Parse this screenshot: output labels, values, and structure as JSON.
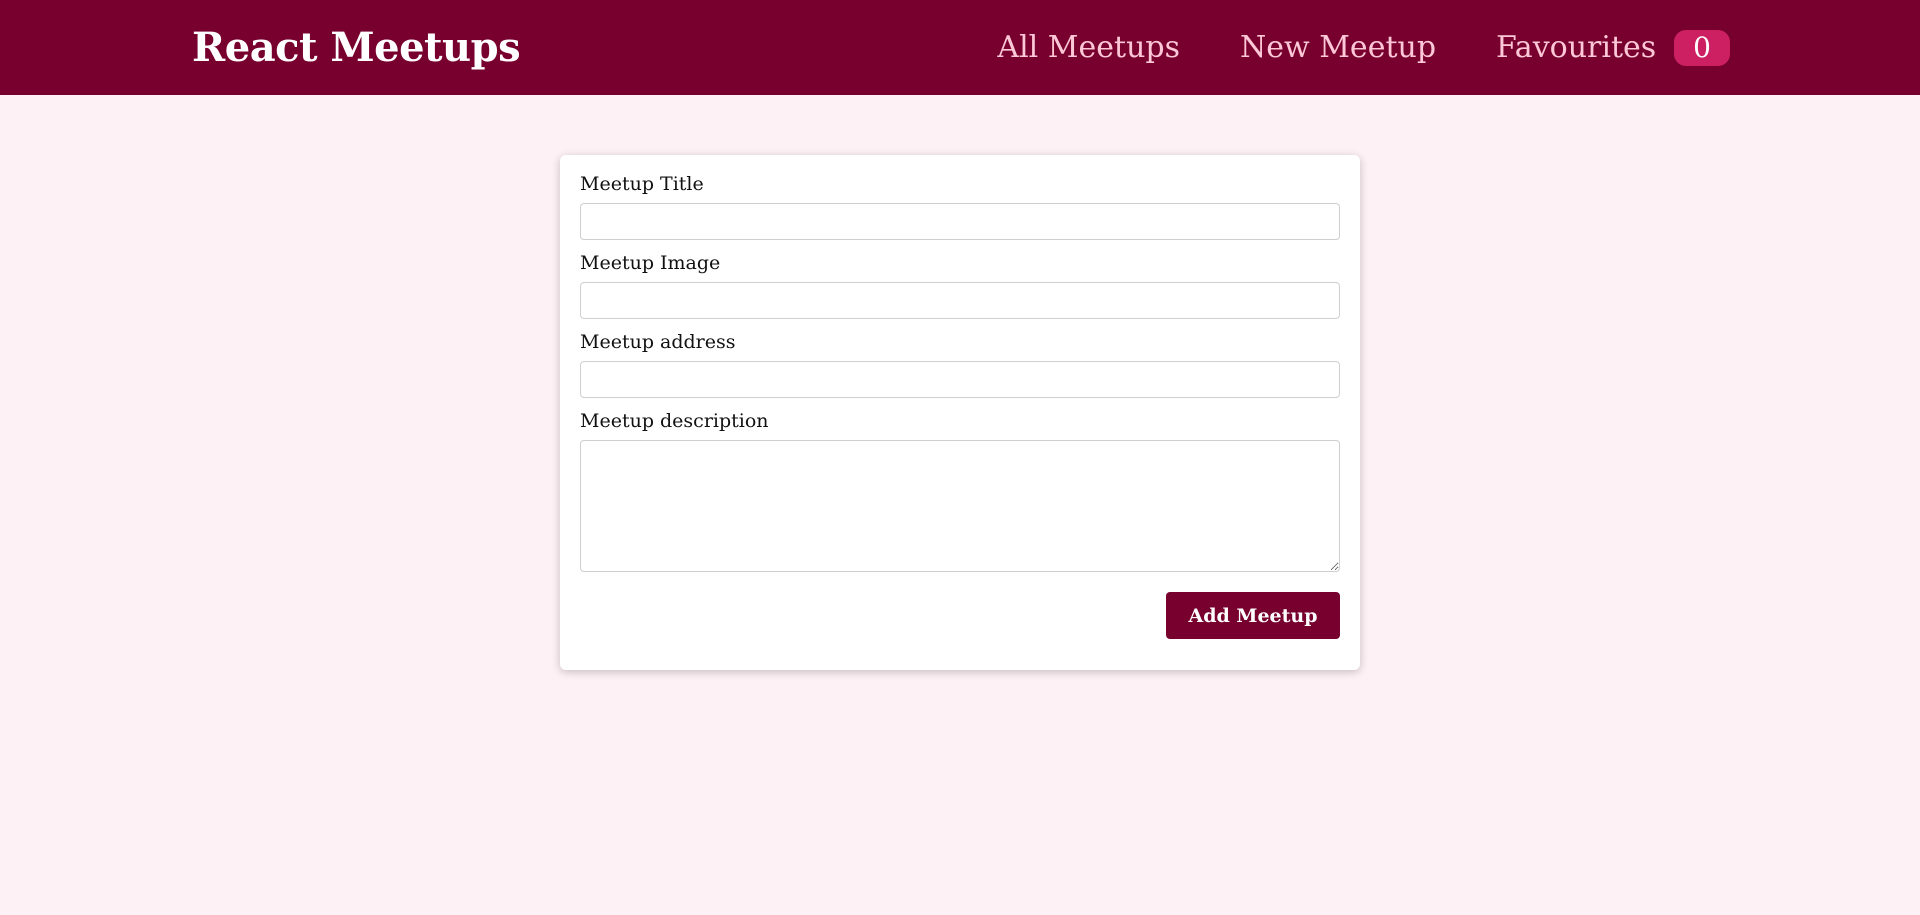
{
  "header": {
    "logo": "React Meetups",
    "nav": {
      "all_meetups": "All Meetups",
      "new_meetup": "New Meetup",
      "favourites": "Favourites",
      "favourites_count": "0"
    }
  },
  "form": {
    "title_label": "Meetup Title",
    "title_value": "",
    "image_label": "Meetup Image",
    "image_value": "",
    "address_label": "Meetup address",
    "address_value": "",
    "description_label": "Meetup description",
    "description_value": "",
    "submit_label": "Add Meetup"
  },
  "colors": {
    "brand": "#77002e",
    "nav_link": "#fcc7d6",
    "badge": "#cc2062",
    "page_background": "#fdf1f5"
  }
}
